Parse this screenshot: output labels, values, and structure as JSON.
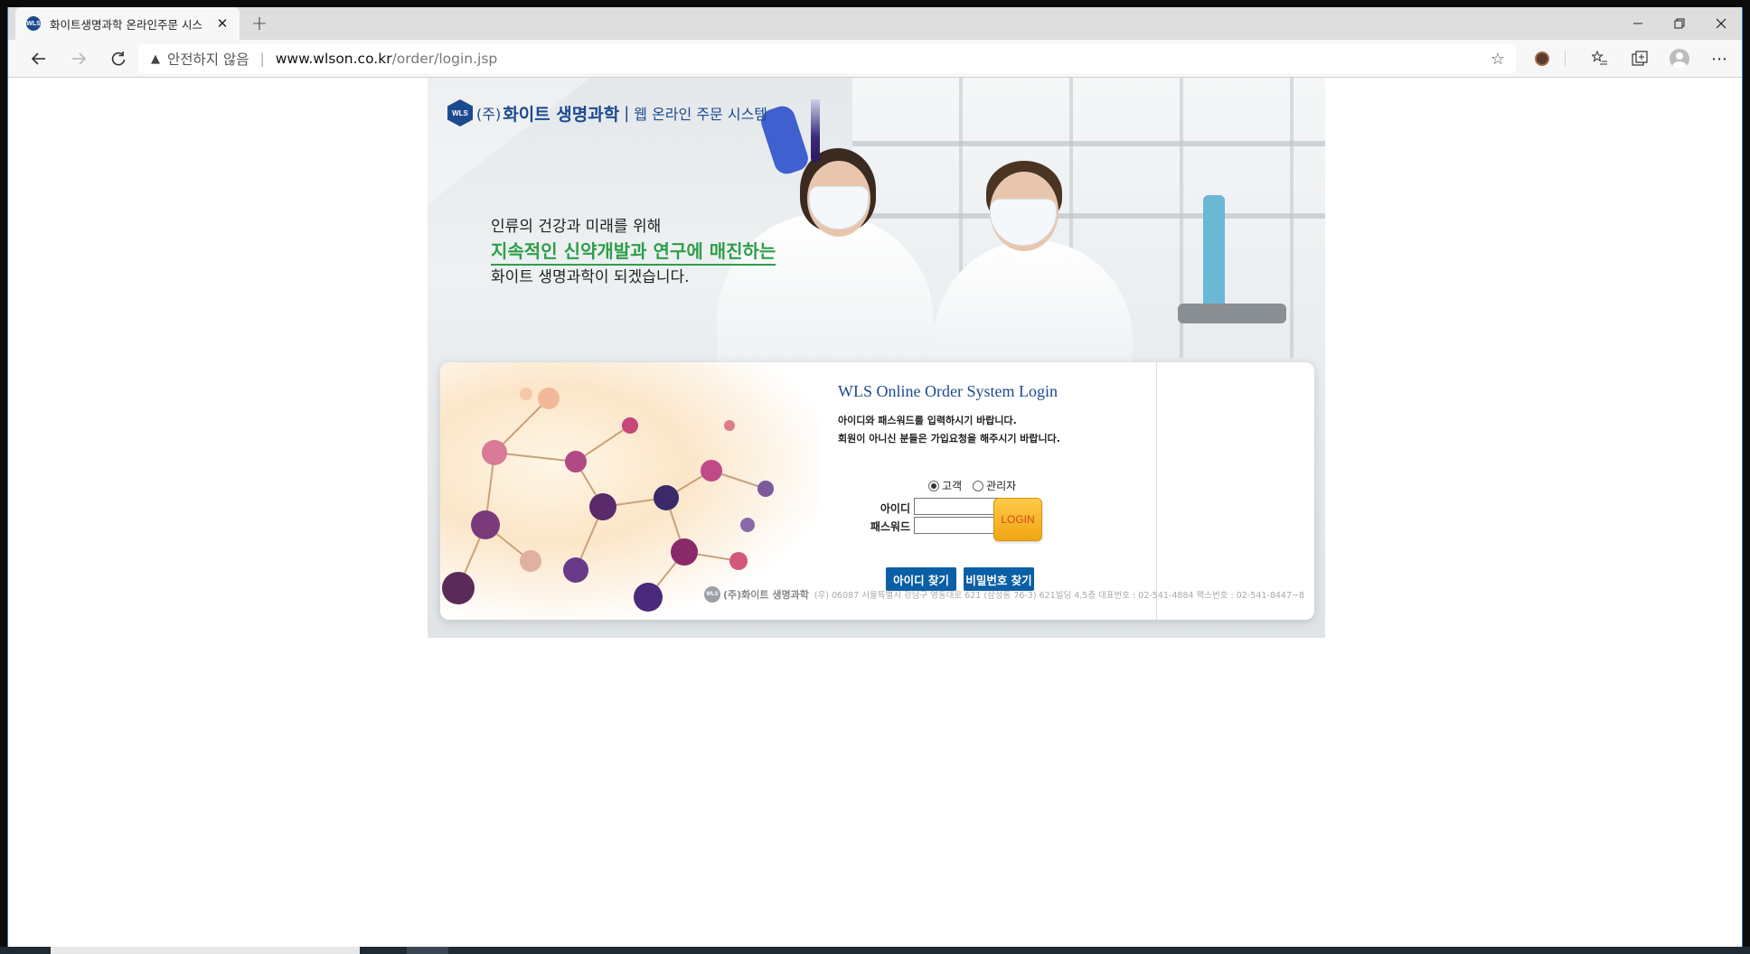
{
  "browser": {
    "tab_title": "화이트생명과학 온라인주문 시스",
    "favicon_text": "WLS",
    "security_text": "안전하지 않음",
    "url_host": "www.wlson.co.kr",
    "url_path": "/order/login.jsp",
    "new_tab_symbol": "+",
    "close_symbol": "✕"
  },
  "header": {
    "logo_badge": "WLS",
    "corp_prefix": "(주)",
    "company_name": "화이트 생명과학",
    "separator": "|",
    "system_name": "웹 온라인 주문 시스템"
  },
  "tagline": {
    "line1": "인류의 건강과 미래를 위해",
    "line2": "지속적인 신약개발과 연구에 매진하는",
    "line3": "화이트 생명과학이 되겠습니다."
  },
  "login": {
    "title": "WLS Online Order System Login",
    "desc_line1": "아이디와 패스워드를 입력하시기 바랍니다.",
    "desc_line2": "회원이 아니신 분들은 가입요청을 해주시기 바랍니다.",
    "roles": [
      {
        "label": "고객",
        "checked": true
      },
      {
        "label": "관리자",
        "checked": false
      }
    ],
    "id_label": "아이디",
    "id_value": "",
    "password_label": "패스워드",
    "password_value": "",
    "login_button": "LOGIN",
    "find_id_button": "아이디 찾기",
    "find_pw_button": "비밀번호 찾기"
  },
  "footer": {
    "badge": "WLS",
    "company": "(주)화이트 생명과학",
    "address": "(우) 06087 서울특별시 강남구 영동대로 621 (삼성동 76-3) 621빌딩 4,5층   대표번호 : 02-541-4884  팩스번호 : 02-541-8447~8"
  },
  "colors": {
    "brand_blue": "#1c4a8f",
    "accent_green": "#2e9e4a",
    "button_blue": "#0a5fa6",
    "login_orange": "#f0a512"
  }
}
